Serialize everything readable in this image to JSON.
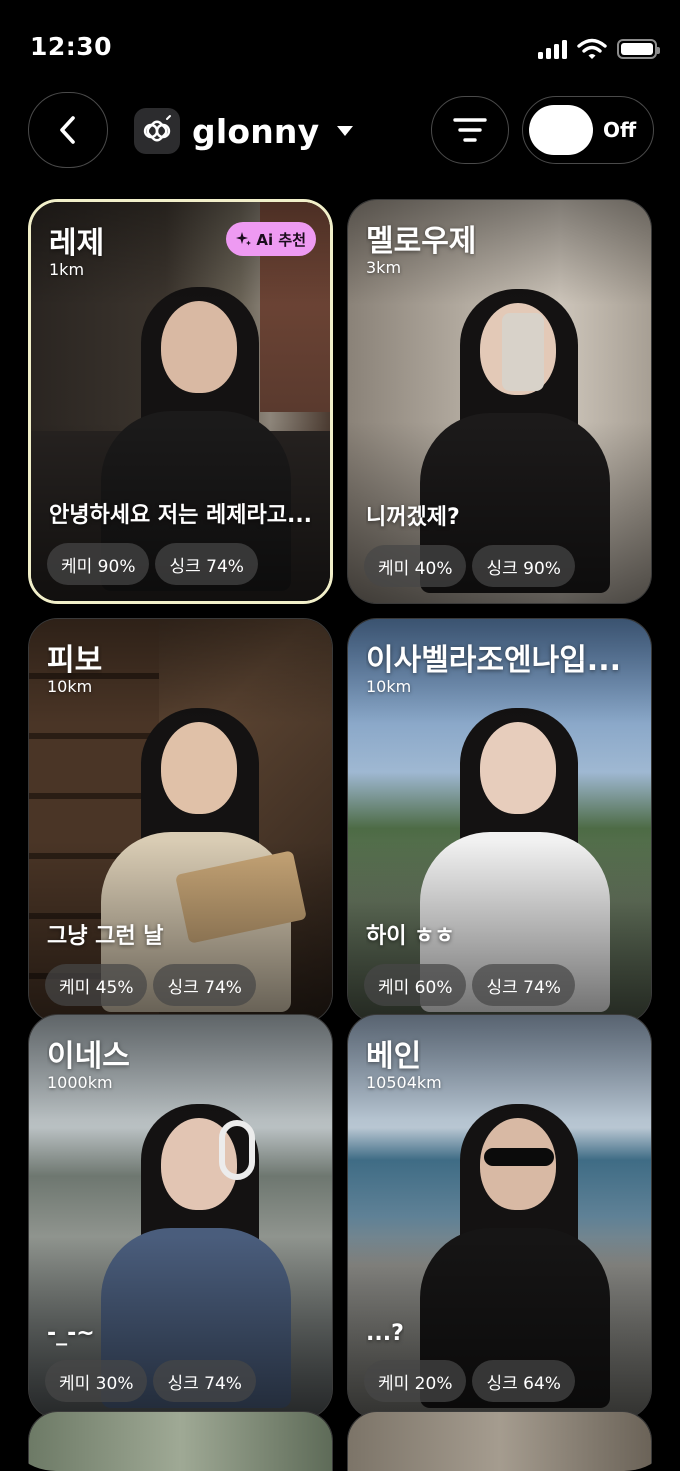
{
  "status_bar": {
    "time": "12:30"
  },
  "header": {
    "app_name": "glonny",
    "toggle_label": "Off"
  },
  "badge": {
    "ai_label": "Ai 추천"
  },
  "cards": [
    {
      "name": "레제",
      "distance": "1km",
      "bio": "안녕하세요 저는 레제라고...",
      "chemi": "케미 90%",
      "sync": "싱크 74%"
    },
    {
      "name": "멜로우제",
      "distance": "3km",
      "bio": "니꺼겠제?",
      "chemi": "케미 40%",
      "sync": "싱크 90%"
    },
    {
      "name": "피보",
      "distance": "10km",
      "bio": "그냥 그런 날",
      "chemi": "케미 45%",
      "sync": "싱크 74%"
    },
    {
      "name": "이사벨라조엔나입...",
      "distance": "10km",
      "bio": "하이 ㅎㅎ",
      "chemi": "케미 60%",
      "sync": "싱크 74%"
    },
    {
      "name": "이네스",
      "distance": "1000km",
      "bio": "-_-~",
      "chemi": "케미 30%",
      "sync": "싱크 74%"
    },
    {
      "name": "베인",
      "distance": "10504km",
      "bio": "...?",
      "chemi": "케미 20%",
      "sync": "싱크 64%"
    }
  ]
}
